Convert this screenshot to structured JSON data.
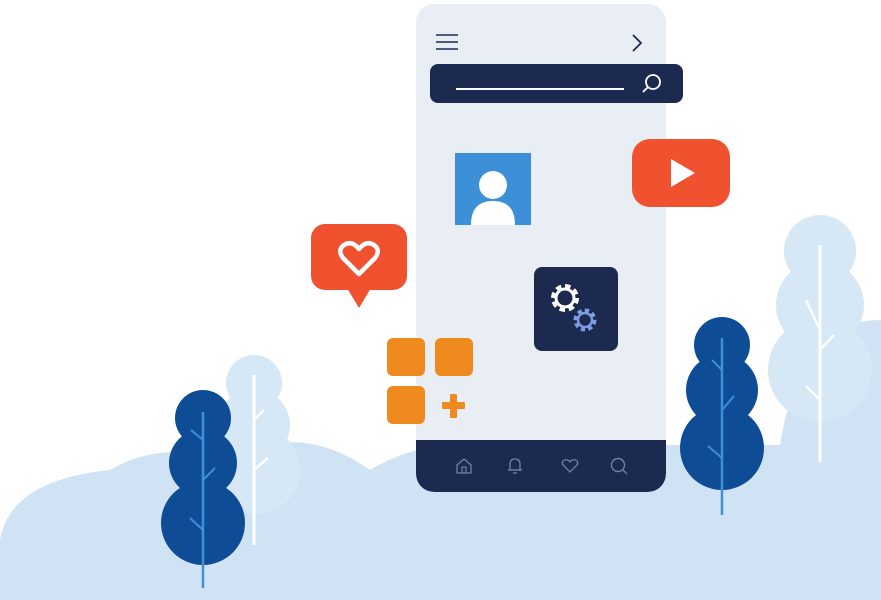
{
  "illustration": {
    "phone": {
      "top_bar": {
        "menu_icon": "hamburger-menu-icon",
        "forward_icon": "chevron-right-icon"
      },
      "search": {
        "icon": "search-icon"
      },
      "bottom_nav": {
        "icons": [
          "home-icon",
          "bell-icon",
          "heart-icon",
          "search-icon"
        ]
      }
    },
    "floating_icons": [
      "profile-avatar-icon",
      "video-play-icon",
      "like-heart-bubble-icon",
      "settings-gears-icon",
      "add-apps-grid-icon"
    ]
  },
  "colors": {
    "phone_screen": "#e9eef4",
    "navy": "#1d2a4f",
    "profile_blue": "#3d8fd8",
    "play_red": "#f0522f",
    "orange": "#ee8a1e",
    "tree_dark": "#0e4c96",
    "tree_light": "#cfe3f5",
    "hills": "#cfe3f5",
    "gear_light": "#7c9de4"
  }
}
